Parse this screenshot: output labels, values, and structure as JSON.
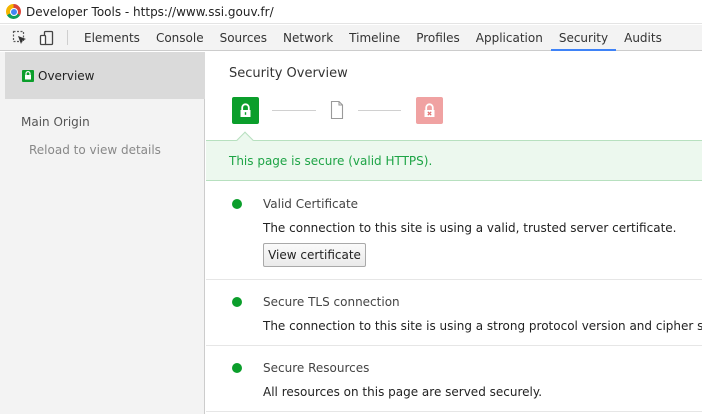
{
  "window": {
    "title": "Developer Tools - https://www.ssi.gouv.fr/"
  },
  "toolbar": {
    "icons": [
      "inspect-element-icon",
      "device-mode-icon"
    ],
    "tabs": [
      {
        "label": "Elements"
      },
      {
        "label": "Console"
      },
      {
        "label": "Sources"
      },
      {
        "label": "Network"
      },
      {
        "label": "Timeline"
      },
      {
        "label": "Profiles"
      },
      {
        "label": "Application"
      },
      {
        "label": "Security",
        "active": true
      },
      {
        "label": "Audits"
      }
    ]
  },
  "sidebar": {
    "overview_label": "Overview",
    "group_title": "Main Origin",
    "group_subtitle": "Reload to view details"
  },
  "main": {
    "title": "Security Overview",
    "states": [
      "secure-lock-icon",
      "info-document-icon",
      "broken-lock-icon"
    ],
    "banner": "This page is secure (valid HTTPS).",
    "sections": [
      {
        "title": "Valid Certificate",
        "description": "The connection to this site is using a valid, trusted server certificate.",
        "button": "View certificate"
      },
      {
        "title": "Secure TLS connection",
        "description": "The connection to this site is using a strong protocol version and cipher suite."
      },
      {
        "title": "Secure Resources",
        "description": "All resources on this page are served securely."
      }
    ]
  },
  "colors": {
    "secure_green": "#0b9e2b",
    "banner_text": "#1ea446",
    "banner_bg": "#ecf8ee",
    "insecure_red": "#f0a2a2",
    "active_tab_underline": "#3e82f7"
  }
}
